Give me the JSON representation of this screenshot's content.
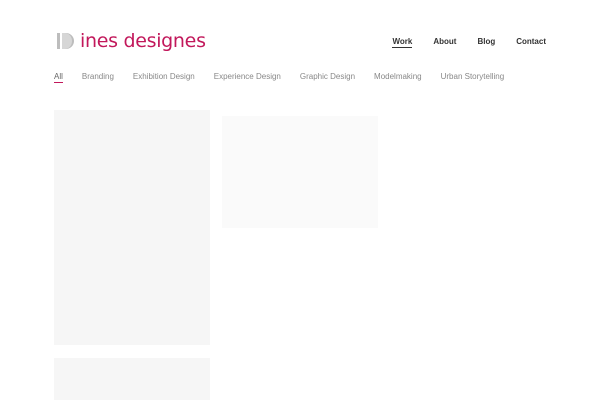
{
  "header": {
    "logo_text": "ines designes",
    "brand_color": "#c2185b",
    "nav": [
      {
        "label": "Work",
        "active": true
      },
      {
        "label": "About",
        "active": false
      },
      {
        "label": "Blog",
        "active": false
      },
      {
        "label": "Contact",
        "active": false
      }
    ]
  },
  "filters": [
    {
      "label": "All",
      "active": true
    },
    {
      "label": "Branding",
      "active": false
    },
    {
      "label": "Exhibition Design",
      "active": false
    },
    {
      "label": "Experience Design",
      "active": false
    },
    {
      "label": "Graphic Design",
      "active": false
    },
    {
      "label": "Modelmaking",
      "active": false
    },
    {
      "label": "Urban Storytelling",
      "active": false
    }
  ]
}
